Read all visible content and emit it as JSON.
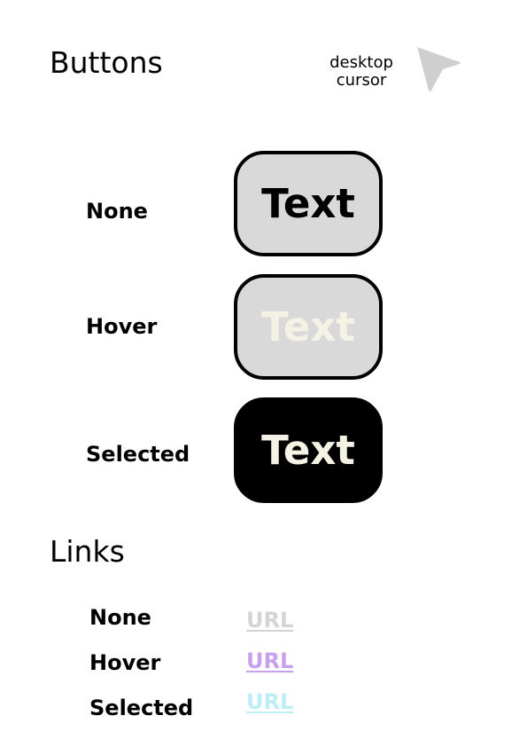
{
  "buttons_section": {
    "title": "Buttons",
    "cursor_note": "desktop\ncursor",
    "cursor_icon": "pointer-cursor-icon",
    "states": [
      {
        "label": "None",
        "button_text": "Text"
      },
      {
        "label": "Hover",
        "button_text": "Text"
      },
      {
        "label": "Selected",
        "button_text": "Text"
      }
    ],
    "colors": {
      "fill_default": "#d9d9d9",
      "fill_selected": "#000000",
      "border": "#000000",
      "text_default": "#000000",
      "text_hover": "#f4f2e4",
      "text_selected": "#f4f2e4",
      "cursor_icon": "#cfcfcf"
    }
  },
  "links_section": {
    "title": "Links",
    "states": [
      {
        "label": "None",
        "link_text": "URL",
        "color": "#d4d4d4"
      },
      {
        "label": "Hover",
        "link_text": "URL",
        "color": "#c9a0ec"
      },
      {
        "label": "Selected",
        "link_text": "URL",
        "color": "#bdeef7"
      }
    ]
  }
}
